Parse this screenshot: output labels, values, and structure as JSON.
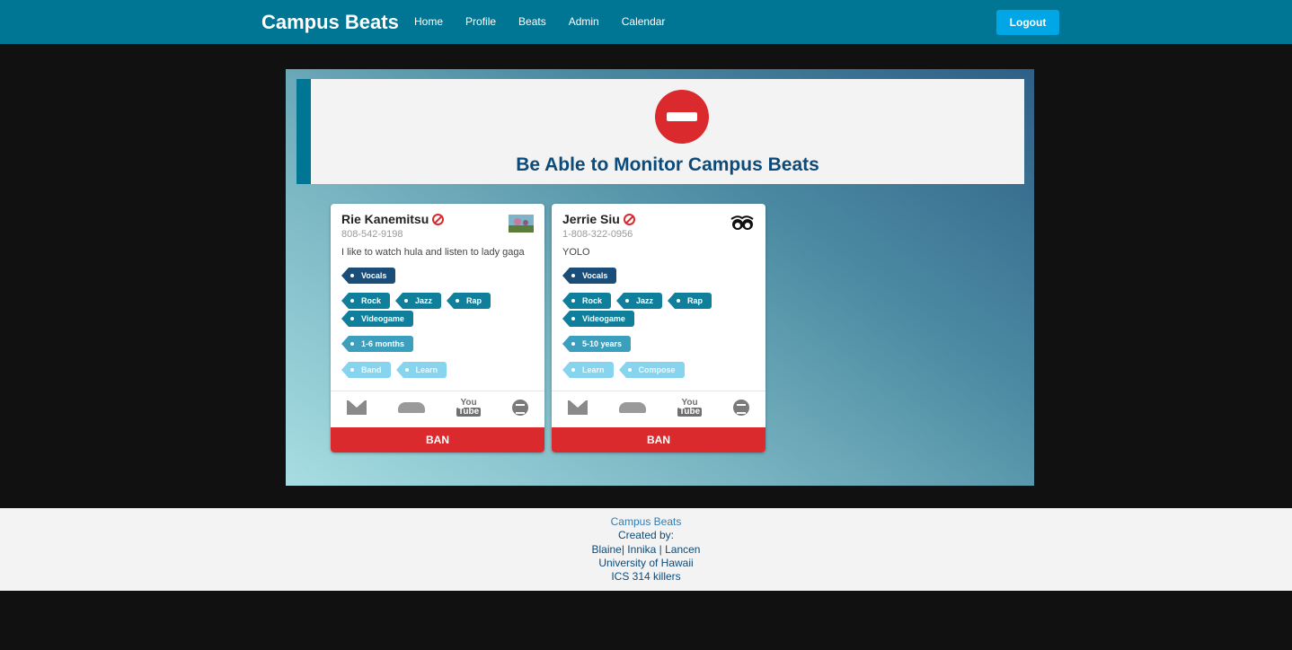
{
  "nav": {
    "brand": "Campus Beats",
    "links": [
      "Home",
      "Profile",
      "Beats",
      "Admin",
      "Calendar"
    ],
    "logout": "Logout"
  },
  "banner": {
    "icon": "no-entry-icon",
    "title": "Be Able to Monitor Campus Beats"
  },
  "cards": [
    {
      "name": "Rie Kanemitsu",
      "phone": "808-542-9198",
      "bio": "I like to watch hula and listen to lady gaga",
      "instruments": [
        "Vocals"
      ],
      "genres": [
        "Rock",
        "Jazz",
        "Rap",
        "Videogame"
      ],
      "experience": "1-6 months",
      "goals": [
        "Band",
        "Learn"
      ],
      "ban_label": "BAN"
    },
    {
      "name": "Jerrie Siu",
      "phone": "1-808-322-0956",
      "bio": "YOLO",
      "instruments": [
        "Vocals"
      ],
      "genres": [
        "Rock",
        "Jazz",
        "Rap",
        "Videogame"
      ],
      "experience": "5-10 years",
      "goals": [
        "Learn",
        "Compose"
      ],
      "ban_label": "BAN"
    }
  ],
  "social_icons": [
    "mail-icon",
    "soundcloud-icon",
    "youtube-icon",
    "spotify-icon"
  ],
  "youtube_text": [
    "You",
    "Tube"
  ],
  "footer": {
    "line1": "Campus Beats",
    "line2": "Created by:",
    "line3": "Blaine| Innika | Lancen",
    "line4": "University of Hawaii",
    "line5": "ICS 314 killers"
  }
}
